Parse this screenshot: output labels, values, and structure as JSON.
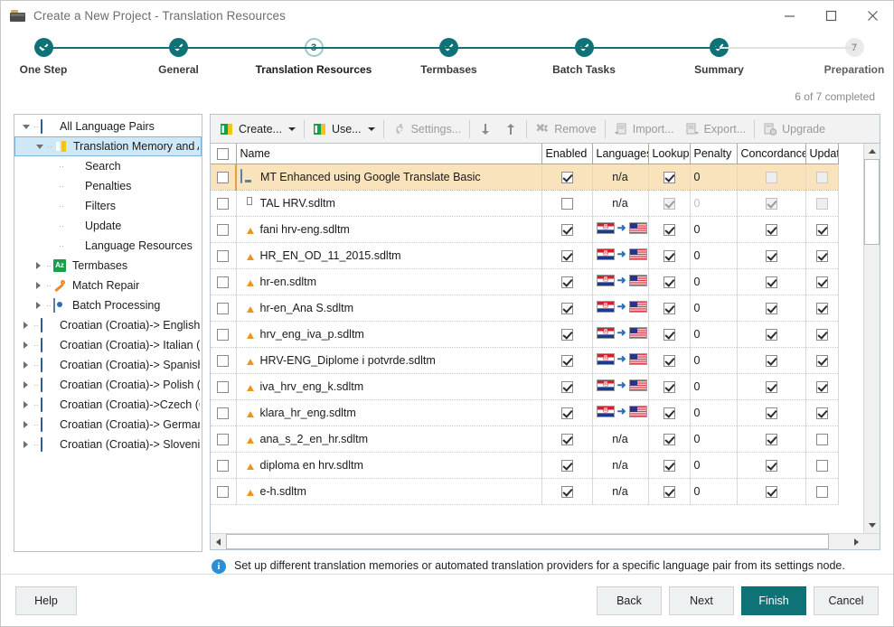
{
  "window": {
    "title": "Create a New Project - Translation Resources",
    "icon": "project-box-icon",
    "minimize": "minimize-icon",
    "maximize": "maximize-icon",
    "close": "close-icon"
  },
  "stepper": {
    "completed_text": "6 of 7 completed",
    "accent_color": "#0f7276",
    "steps": [
      {
        "label": "One Step",
        "state": "done",
        "marker": "check"
      },
      {
        "label": "General",
        "state": "done",
        "marker": "check"
      },
      {
        "label": "Translation Resources",
        "state": "current",
        "marker": "3"
      },
      {
        "label": "Termbases",
        "state": "done",
        "marker": "check"
      },
      {
        "label": "Batch Tasks",
        "state": "done",
        "marker": "check"
      },
      {
        "label": "Summary",
        "state": "done",
        "marker": "check"
      },
      {
        "label": "Preparation",
        "state": "todo",
        "marker": "7"
      }
    ]
  },
  "tree": [
    {
      "label": "All Language Pairs",
      "depth": 0,
      "expander": "down",
      "icon": "globe-icon",
      "selected": false
    },
    {
      "label": "Translation Memory and Aut",
      "depth": 1,
      "expander": "down",
      "icon": "translation-memory-icon",
      "selected": true
    },
    {
      "label": "Search",
      "depth": 2,
      "expander": "none",
      "icon": "none",
      "selected": false
    },
    {
      "label": "Penalties",
      "depth": 2,
      "expander": "none",
      "icon": "none",
      "selected": false
    },
    {
      "label": "Filters",
      "depth": 2,
      "expander": "none",
      "icon": "none",
      "selected": false
    },
    {
      "label": "Update",
      "depth": 2,
      "expander": "none",
      "icon": "none",
      "selected": false
    },
    {
      "label": "Language Resources",
      "depth": 2,
      "expander": "none",
      "icon": "none",
      "selected": false
    },
    {
      "label": "Termbases",
      "depth": 1,
      "expander": "right",
      "icon": "termbase-icon",
      "selected": false
    },
    {
      "label": "Match Repair",
      "depth": 1,
      "expander": "right",
      "icon": "wrench-icon",
      "selected": false
    },
    {
      "label": "Batch Processing",
      "depth": 1,
      "expander": "right",
      "icon": "batch-gear-icon",
      "selected": false
    },
    {
      "label": "Croatian (Croatia)-> English (Unit",
      "depth": 0,
      "expander": "right",
      "icon": "globe-icon",
      "selected": false
    },
    {
      "label": "Croatian (Croatia)-> Italian (Italy)",
      "depth": 0,
      "expander": "right",
      "icon": "globe-icon",
      "selected": false
    },
    {
      "label": "Croatian (Croatia)-> Spanish (Spa",
      "depth": 0,
      "expander": "right",
      "icon": "globe-icon",
      "selected": false
    },
    {
      "label": "Croatian (Croatia)-> Polish (Polan",
      "depth": 0,
      "expander": "right",
      "icon": "globe-icon",
      "selected": false
    },
    {
      "label": "Croatian (Croatia)->Czech (Czec",
      "depth": 0,
      "expander": "right",
      "icon": "globe-icon",
      "selected": false
    },
    {
      "label": "Croatian (Croatia)-> German (Ger",
      "depth": 0,
      "expander": "right",
      "icon": "globe-icon",
      "selected": false
    },
    {
      "label": "Croatian (Croatia)-> Slovenian (Sl",
      "depth": 0,
      "expander": "right",
      "icon": "globe-icon",
      "selected": false
    }
  ],
  "toolbar": {
    "create_label": "Create...",
    "use_label": "Use...",
    "settings_label": "Settings...",
    "remove_label": "Remove",
    "import_label": "Import...",
    "export_label": "Export...",
    "upgrade_label": "Upgrade",
    "move_down_icon": "arrow-down-icon",
    "move_up_icon": "arrow-up-icon"
  },
  "grid": {
    "columns": [
      {
        "key": "select",
        "label": ""
      },
      {
        "key": "name",
        "label": "Name"
      },
      {
        "key": "enabled",
        "label": "Enabled"
      },
      {
        "key": "languages",
        "label": "Languages"
      },
      {
        "key": "lookup",
        "label": "Lookup"
      },
      {
        "key": "penalty",
        "label": "Penalty"
      },
      {
        "key": "concordance",
        "label": "Concordance"
      },
      {
        "key": "update",
        "label": "Updat"
      }
    ],
    "rows": [
      {
        "name": "MT Enhanced using Google Translate Basic",
        "icon": "machine-translation-icon",
        "selected": false,
        "highlight": true,
        "enabled": "checked",
        "languages": "n/a",
        "lookup": "checked",
        "penalty": "0",
        "concordance": "blank",
        "update": "blank",
        "disabled": false
      },
      {
        "name": "TAL HRV.sdltm",
        "icon": "translation-memory-copy-icon",
        "selected": false,
        "highlight": false,
        "enabled": "unchecked",
        "languages": "n/a",
        "lookup": "checked-disabled",
        "penalty": "0",
        "concordance": "checked-disabled",
        "update": "blank",
        "disabled": true
      },
      {
        "name": "fani hrv-eng.sdltm",
        "icon": "translation-memory-icon",
        "selected": false,
        "highlight": false,
        "enabled": "checked",
        "languages": "hr-en",
        "lookup": "checked",
        "penalty": "0",
        "concordance": "checked",
        "update": "checked",
        "disabled": false
      },
      {
        "name": "HR_EN_OD_11_2015.sdltm",
        "icon": "translation-memory-icon",
        "selected": false,
        "highlight": false,
        "enabled": "checked",
        "languages": "hr-en",
        "lookup": "checked",
        "penalty": "0",
        "concordance": "checked",
        "update": "checked",
        "disabled": false
      },
      {
        "name": "hr-en.sdltm",
        "icon": "translation-memory-icon",
        "selected": false,
        "highlight": false,
        "enabled": "checked",
        "languages": "hr-en",
        "lookup": "checked",
        "penalty": "0",
        "concordance": "checked",
        "update": "checked",
        "disabled": false
      },
      {
        "name": "hr-en_Ana S.sdltm",
        "icon": "translation-memory-icon",
        "selected": false,
        "highlight": false,
        "enabled": "checked",
        "languages": "hr-en",
        "lookup": "checked",
        "penalty": "0",
        "concordance": "checked",
        "update": "checked",
        "disabled": false
      },
      {
        "name": "hrv_eng_iva_p.sdltm",
        "icon": "translation-memory-icon",
        "selected": false,
        "highlight": false,
        "enabled": "checked",
        "languages": "hr-en",
        "lookup": "checked",
        "penalty": "0",
        "concordance": "checked",
        "update": "checked",
        "disabled": false
      },
      {
        "name": "HRV-ENG_Diplome i potvrde.sdltm",
        "icon": "translation-memory-icon",
        "selected": false,
        "highlight": false,
        "enabled": "checked",
        "languages": "hr-en",
        "lookup": "checked",
        "penalty": "0",
        "concordance": "checked",
        "update": "checked",
        "disabled": false
      },
      {
        "name": "iva_hrv_eng_k.sdltm",
        "icon": "translation-memory-icon",
        "selected": false,
        "highlight": false,
        "enabled": "checked",
        "languages": "hr-en",
        "lookup": "checked",
        "penalty": "0",
        "concordance": "checked",
        "update": "checked",
        "disabled": false
      },
      {
        "name": "klara_hr_eng.sdltm",
        "icon": "translation-memory-icon",
        "selected": false,
        "highlight": false,
        "enabled": "checked",
        "languages": "hr-en",
        "lookup": "checked",
        "penalty": "0",
        "concordance": "checked",
        "update": "checked",
        "disabled": false
      },
      {
        "name": "ana_s_2_en_hr.sdltm",
        "icon": "translation-memory-icon",
        "selected": false,
        "highlight": false,
        "enabled": "checked",
        "languages": "n/a",
        "lookup": "checked",
        "penalty": "0",
        "concordance": "checked",
        "update": "unchecked",
        "disabled": false
      },
      {
        "name": "diploma en hrv.sdltm",
        "icon": "translation-memory-icon",
        "selected": false,
        "highlight": false,
        "enabled": "checked",
        "languages": "n/a",
        "lookup": "checked",
        "penalty": "0",
        "concordance": "checked",
        "update": "unchecked",
        "disabled": false
      },
      {
        "name": "e-h.sdltm",
        "icon": "translation-memory-icon",
        "selected": false,
        "highlight": false,
        "enabled": "checked",
        "languages": "n/a",
        "lookup": "checked",
        "penalty": "0",
        "concordance": "checked",
        "update": "unchecked",
        "disabled": false
      }
    ]
  },
  "info": {
    "text": "Set up different translation memories or automated translation providers for a specific language pair from its settings node.",
    "icon": "info-icon"
  },
  "footer": {
    "help": "Help",
    "back": "Back",
    "next": "Next",
    "finish": "Finish",
    "cancel": "Cancel",
    "primary_color": "#0f7276"
  }
}
